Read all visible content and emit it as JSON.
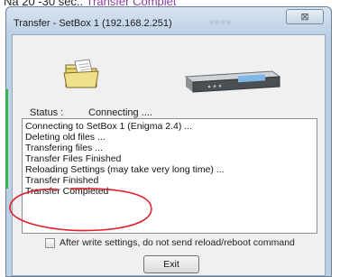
{
  "background": {
    "prefix": "Na 20 -30 sec.. ",
    "accent_text": "Transfer Complet"
  },
  "window": {
    "title": "Transfer - SetBox 1 (192.168.2.251)",
    "title_extra": "• ▪ • ▪",
    "close_symbol": "⊠"
  },
  "status": {
    "label": "Status :",
    "value": "Connecting ...."
  },
  "log": {
    "lines": [
      "Connecting to SetBox 1 (Enigma 2.4) ...",
      "Deleting old files ...",
      "Transfering files ...",
      "Transfer Files Finished",
      "Reloading Settings (may take very long time) ...",
      "Transfer Finished",
      "Transfer Completed"
    ]
  },
  "options": {
    "no_reload_label": "After write settings, do not send reload/reboot command",
    "no_reload_checked": false
  },
  "buttons": {
    "exit_label": "Exit"
  },
  "colors": {
    "annotation": "#e0202a",
    "accent": "#8b3fa0"
  },
  "icons": {
    "folder": "folder-icon",
    "device": "setbox-icon"
  }
}
